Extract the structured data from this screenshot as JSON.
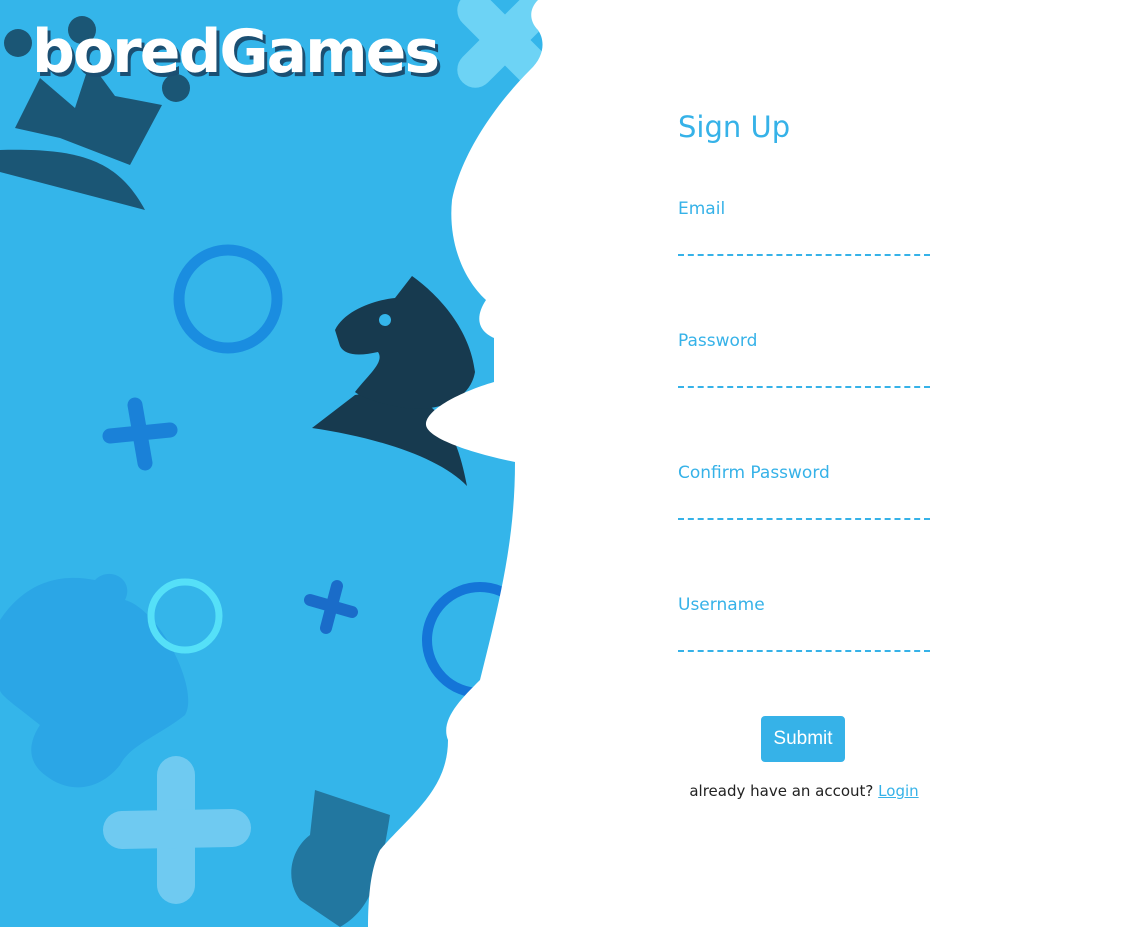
{
  "brand": {
    "logo_text": "boredGames"
  },
  "colors": {
    "accent": "#36b2e8",
    "panel_background": "#34b5ea",
    "dark_navy": "#173a4f",
    "white": "#ffffff"
  },
  "decor": {
    "icons": [
      "crown-icon",
      "chess-knight-icon",
      "chess-bishop-icon",
      "puzzle-piece-icon",
      "ring-icon",
      "cross-icon"
    ]
  },
  "form": {
    "title": "Sign Up",
    "fields": [
      {
        "label": "Email",
        "value": "",
        "type": "email"
      },
      {
        "label": "Password",
        "value": "",
        "type": "password"
      },
      {
        "label": "Confirm Password",
        "value": "",
        "type": "password"
      },
      {
        "label": "Username",
        "value": "",
        "type": "text"
      }
    ],
    "submit_label": "Submit",
    "login_prompt": "already have an accout?",
    "login_link": "Login"
  }
}
